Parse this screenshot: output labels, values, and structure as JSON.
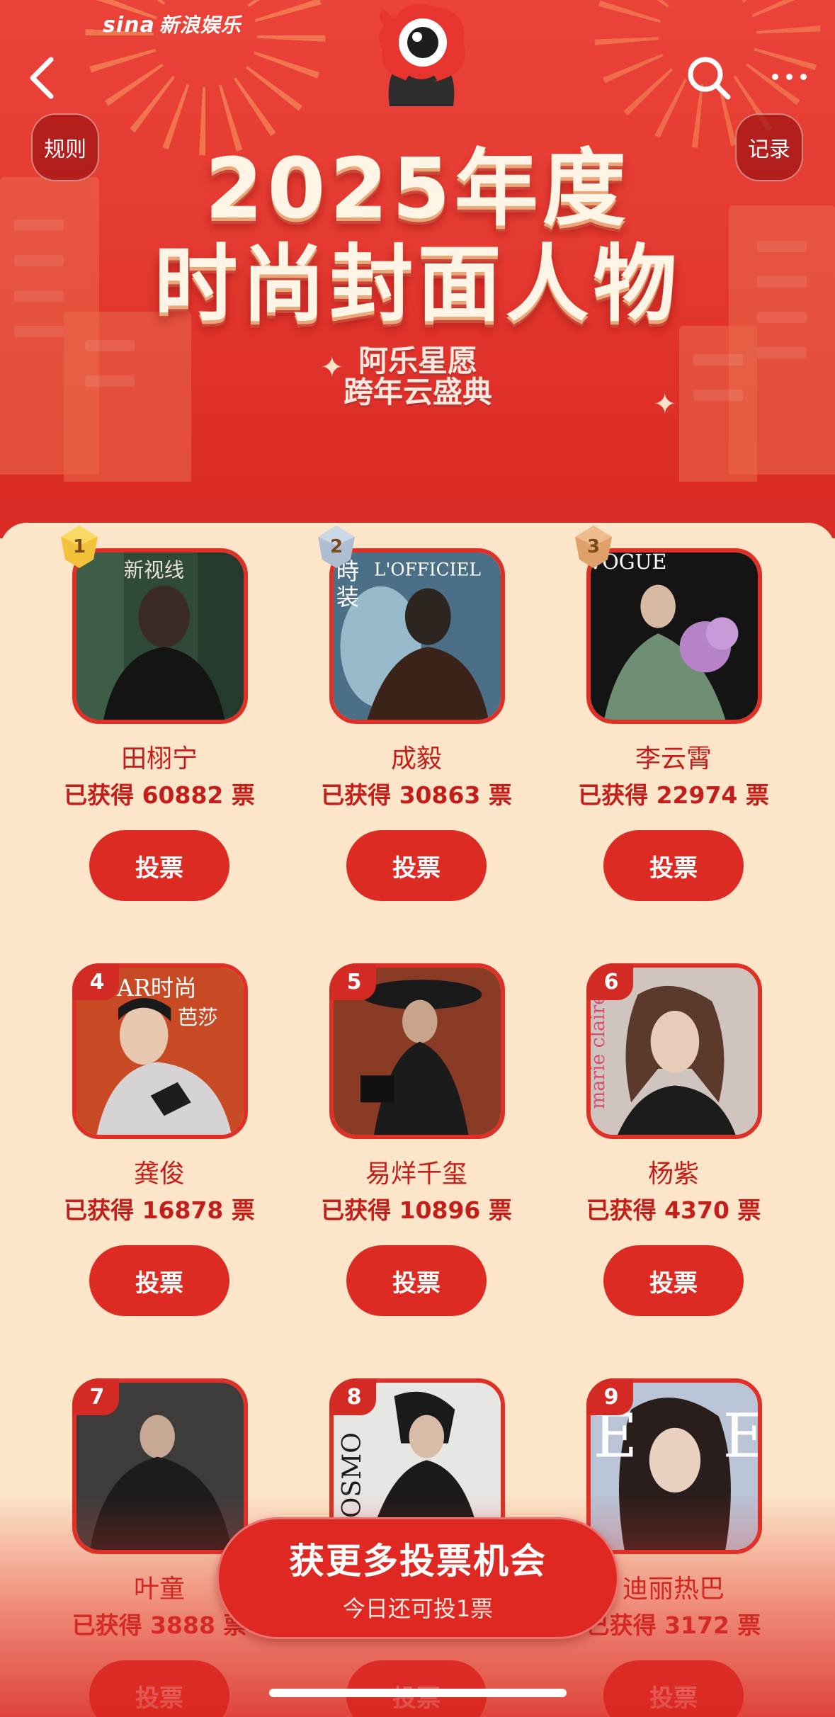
{
  "brand": {
    "logo_text": "sina",
    "name": "新浪娱乐"
  },
  "header": {
    "title_line1": "2025年度",
    "title_line2": "时尚封面人物",
    "sub_logo_line1": "阿乐星愿",
    "sub_logo_line2": "跨年云盛典",
    "rules_label": "规则",
    "record_label": "记录"
  },
  "candidates": [
    {
      "rank": "1",
      "name": "田栩宁",
      "votes": "已获得 60882 票",
      "vote_label": "投票"
    },
    {
      "rank": "2",
      "name": "成毅",
      "votes": "已获得 30863 票",
      "vote_label": "投票"
    },
    {
      "rank": "3",
      "name": "李云霄",
      "votes": "已获得 22974 票",
      "vote_label": "投票"
    },
    {
      "rank": "4",
      "name": "龚俊",
      "votes": "已获得 16878 票",
      "vote_label": "投票"
    },
    {
      "rank": "5",
      "name": "易烊千玺",
      "votes": "已获得 10896 票",
      "vote_label": "投票"
    },
    {
      "rank": "6",
      "name": "杨紫",
      "votes": "已获得 4370 票",
      "vote_label": "投票"
    },
    {
      "rank": "7",
      "name": "叶童",
      "votes": "已获得 3888 票",
      "vote_label": "投票"
    },
    {
      "rank": "8",
      "name": "",
      "votes": "",
      "vote_label": "投票"
    },
    {
      "rank": "9",
      "name": "迪丽热巴",
      "votes": "已获得 3172 票",
      "vote_label": "投票"
    }
  ],
  "cta": {
    "title": "获更多投票机会",
    "subtitle": "今日还可投1票"
  },
  "colors": {
    "primary_red": "#dd2a22",
    "text_red": "#c41e1a",
    "panel_bg": "#fce5c8"
  },
  "icons": {
    "back": "chevron-left-icon",
    "search": "search-icon",
    "more": "more-dots-icon"
  }
}
